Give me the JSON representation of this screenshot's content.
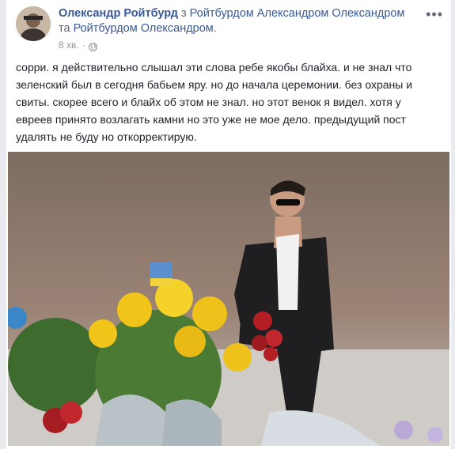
{
  "post": {
    "author": "Олександр Ройтбурд",
    "connector_1": " з ",
    "tagged_1": "Ройтбурдом Александром Олександром",
    "connector_2": " та ",
    "tagged_2": "Ройтбурдом Олександром",
    "end": ".",
    "timestamp": "8 хв.",
    "dot": "·",
    "privacy_icon": "globe-icon",
    "more_label": "•••",
    "text": "сорри. я действительно слышал эти слова ребе якобы блайха. и не знал что зеленский был в сегодня бабьем яру. но до начала церемонии. без охраны и свиты. скорее всего и блайх об этом не знал. но этот венок я видел. хотя у евреев принято возлагать камни но это уже не мое дело. предыдущий пост удалять не буду но откорректирую."
  },
  "colors": {
    "link": "#385898",
    "text": "#1d2129",
    "meta": "#90949c",
    "background": "#e9ebee"
  }
}
